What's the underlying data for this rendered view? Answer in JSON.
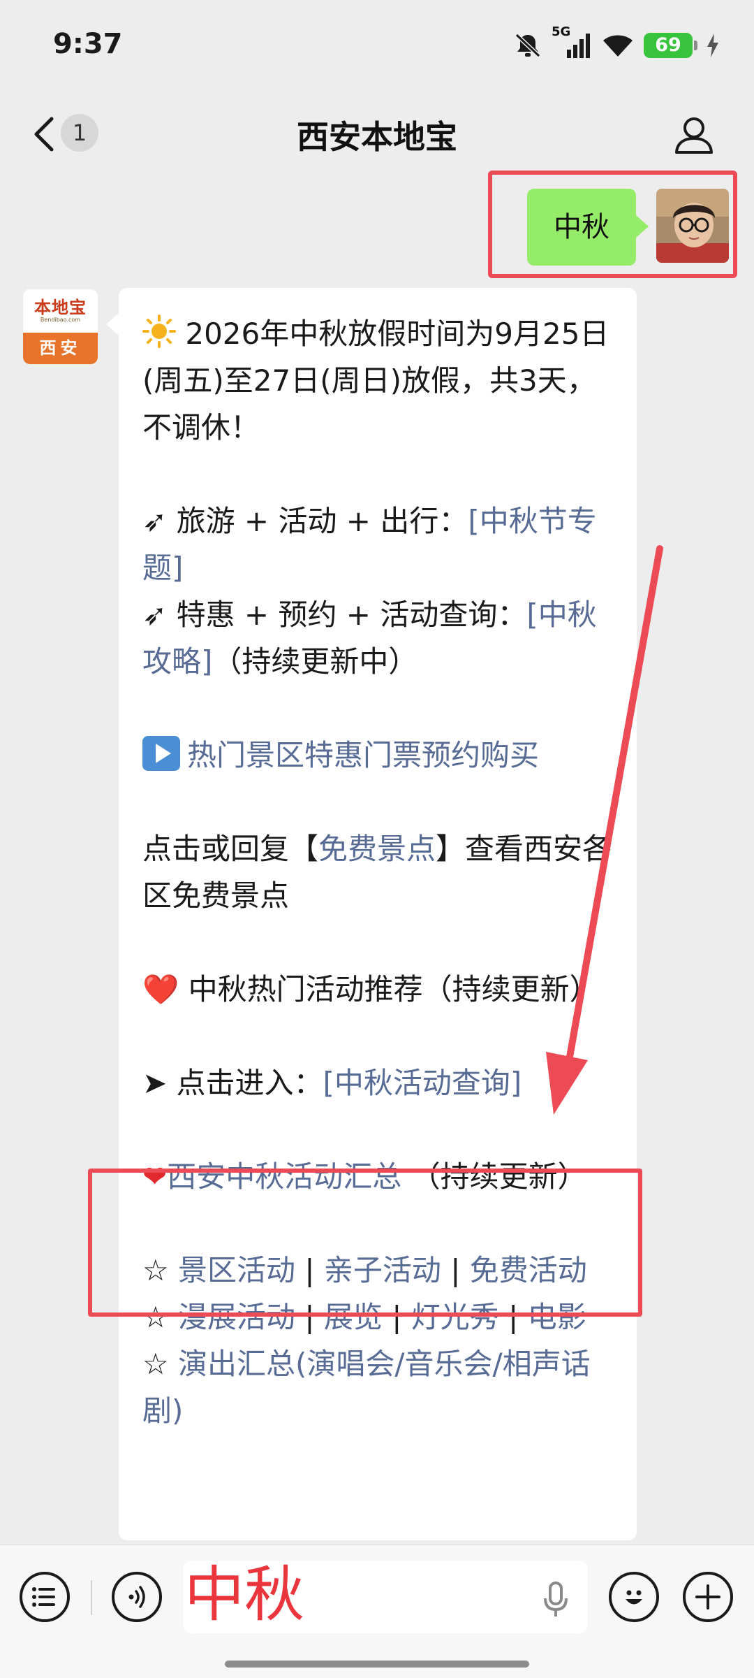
{
  "status_bar": {
    "time": "9:37",
    "network": "5G",
    "battery_level": "69",
    "icons": [
      "mute-icon",
      "signal-icon",
      "wifi-icon",
      "battery-icon",
      "charging-icon"
    ]
  },
  "nav": {
    "title": "西安本地宝",
    "unread_count": "1",
    "icons": [
      "back-icon",
      "profile-icon"
    ]
  },
  "outgoing_message": {
    "text": "中秋"
  },
  "bot": {
    "avatar_logo": "本地宝",
    "avatar_logo_sub": "Bendibao.com",
    "avatar_city": "西安"
  },
  "incoming_message": {
    "line1": "2026年中秋放假时间为9月25日(周五)至27日(周日)放假，共3天，不调休！",
    "travel_prefix": "旅游 + 活动 + 出行：",
    "travel_link": "[中秋节专题]",
    "deals_prefix": "特惠 + 预约 + 活动查询：",
    "deals_link": "[中秋攻略]",
    "deals_suffix": "（持续更新中）",
    "tickets_link": "热门景区特惠门票预约购买",
    "free_prefix": "点击或回复【",
    "free_link": "免费景点",
    "free_suffix": "】查看西安各区免费景点",
    "hot_heart": "❤️",
    "hot_text": "中秋热门活动推荐（持续更新）",
    "enter_prefix": "➤ 点击进入：",
    "enter_link": "[中秋活动查询]",
    "summary_link": "西安中秋活动汇总",
    "summary_suffix": "（持续更新）",
    "cat_row1": [
      "景区活动",
      "亲子活动",
      "免费活动"
    ],
    "cat_row2": [
      "漫展活动",
      "展览",
      "灯光秀",
      "电影"
    ],
    "cat_row3_link": "演出汇总(演唱会/音乐会/相声话剧)"
  },
  "input_bar": {
    "text": "中秋",
    "icons": [
      "menu-icon",
      "voice-icon",
      "mic-icon",
      "emoji-icon",
      "plus-icon"
    ]
  },
  "colors": {
    "outgoing_bubble": "#95ec69",
    "link": "#576b95",
    "highlight": "#ec4a54",
    "background": "#ededed"
  }
}
